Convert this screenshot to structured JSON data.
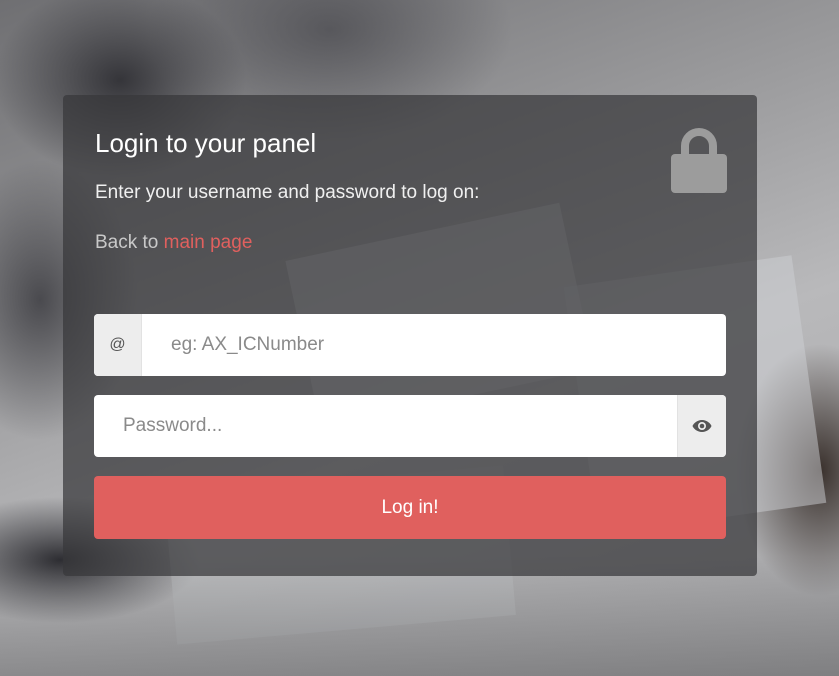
{
  "panel": {
    "title": "Login to your panel",
    "subtitle": "Enter your username and password to log on:",
    "back_prefix": "Back to",
    "back_link": "main page"
  },
  "form": {
    "username_addon": "@",
    "username_placeholder": "eg: AX_ICNumber",
    "password_placeholder": "Password...",
    "submit_label": "Log in!"
  },
  "icons": {
    "lock": "lock-icon",
    "eye": "eye-icon"
  },
  "colors": {
    "accent": "#e0605e",
    "panel_bg": "#37383a"
  }
}
